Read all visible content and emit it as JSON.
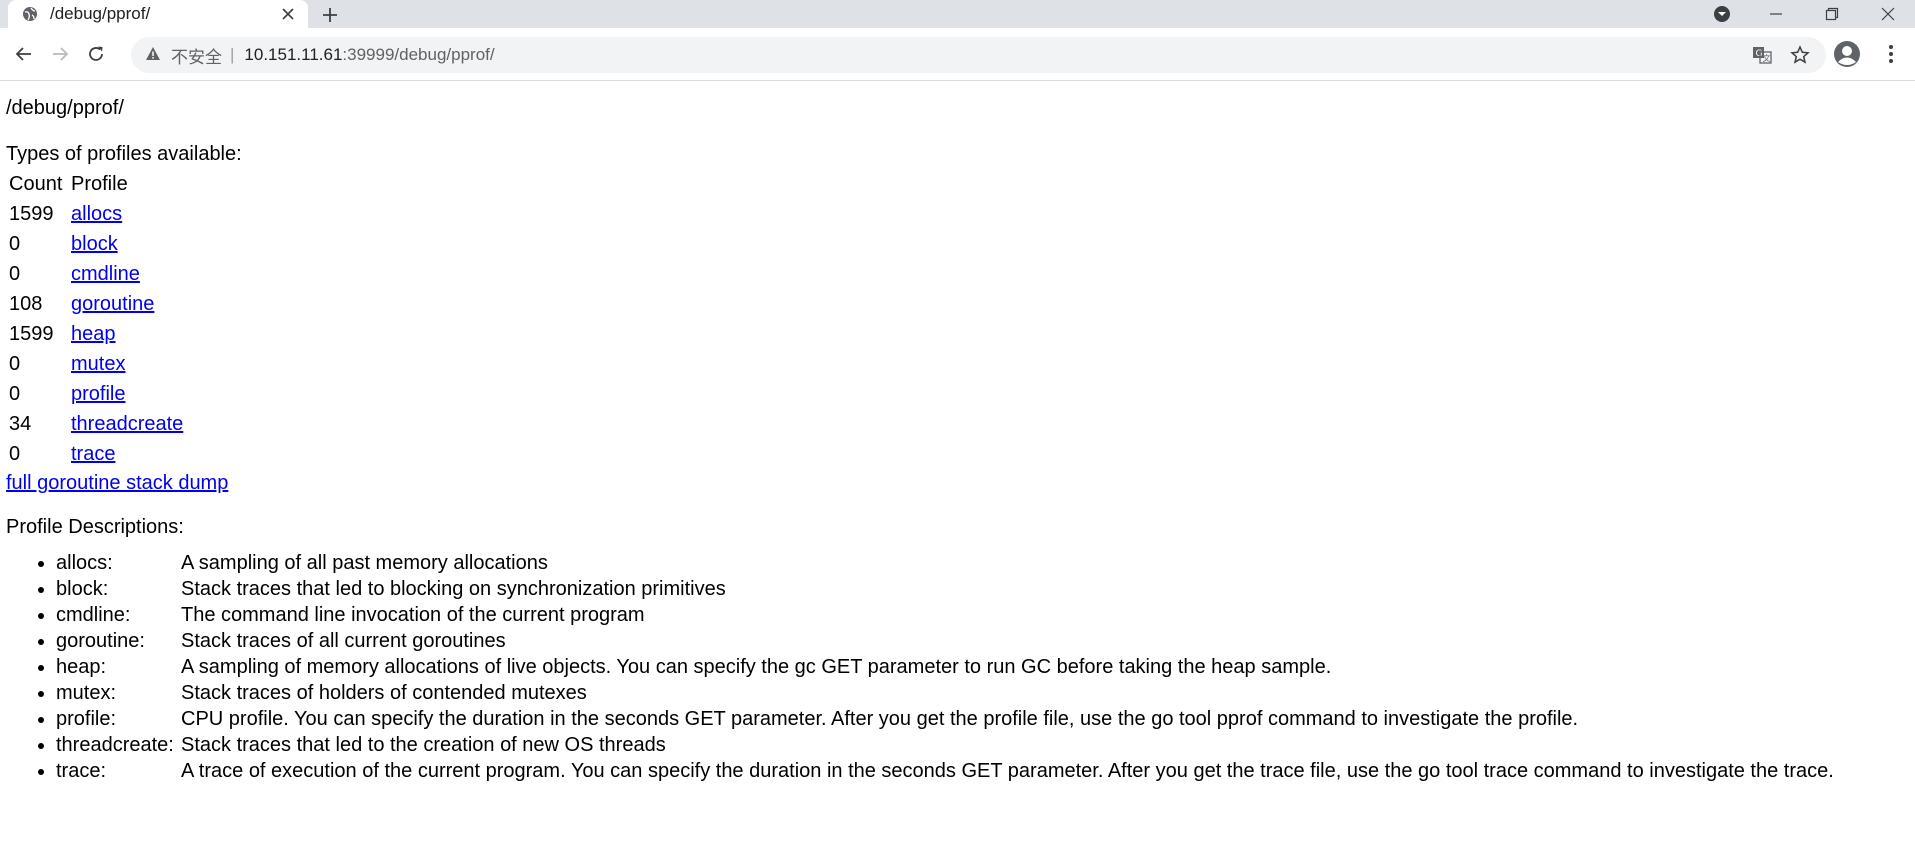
{
  "browser": {
    "tab_title": "/debug/pprof/",
    "url_security": "不安全",
    "url_host": "10.151.11.61",
    "url_rest": ":39999/debug/pprof/"
  },
  "page": {
    "title": "/debug/pprof/",
    "types_label": "Types of profiles available:",
    "table_headers": {
      "count": "Count",
      "profile": "Profile"
    },
    "profiles": [
      {
        "count": "1599",
        "name": "allocs"
      },
      {
        "count": "0",
        "name": "block"
      },
      {
        "count": "0",
        "name": "cmdline"
      },
      {
        "count": "108",
        "name": "goroutine"
      },
      {
        "count": "1599",
        "name": "heap"
      },
      {
        "count": "0",
        "name": "mutex"
      },
      {
        "count": "0",
        "name": "profile"
      },
      {
        "count": "34",
        "name": "threadcreate"
      },
      {
        "count": "0",
        "name": "trace"
      }
    ],
    "full_dump_link": "full goroutine stack dump",
    "descriptions_label": "Profile Descriptions:",
    "descriptions": [
      {
        "key": "allocs:",
        "text": "A sampling of all past memory allocations"
      },
      {
        "key": "block:",
        "text": "Stack traces that led to blocking on synchronization primitives"
      },
      {
        "key": "cmdline:",
        "text": "The command line invocation of the current program"
      },
      {
        "key": "goroutine:",
        "text": "Stack traces of all current goroutines"
      },
      {
        "key": "heap:",
        "text": "A sampling of memory allocations of live objects. You can specify the gc GET parameter to run GC before taking the heap sample."
      },
      {
        "key": "mutex:",
        "text": "Stack traces of holders of contended mutexes"
      },
      {
        "key": "profile:",
        "text": "CPU profile. You can specify the duration in the seconds GET parameter. After you get the profile file, use the go tool pprof command to investigate the profile."
      },
      {
        "key": "threadcreate:",
        "text": "Stack traces that led to the creation of new OS threads"
      },
      {
        "key": "trace:",
        "text": "A trace of execution of the current program. You can specify the duration in the seconds GET parameter. After you get the trace file, use the go tool trace command to investigate the trace."
      }
    ]
  }
}
